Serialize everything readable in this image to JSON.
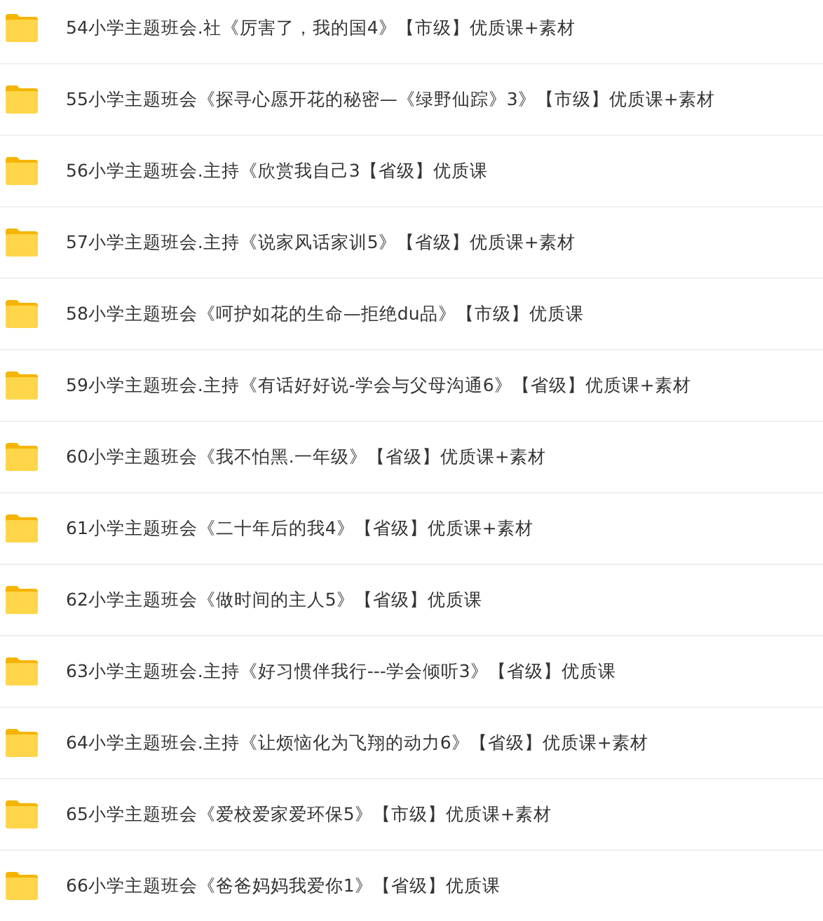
{
  "items": [
    {
      "name": "54小学主题班会.社《厉害了，我的国4》【市级】优质课+素材"
    },
    {
      "name": "55小学主题班会《探寻心愿开花的秘密—《绿野仙踪》3》【市级】优质课+素材"
    },
    {
      "name": "56小学主题班会.主持《欣赏我自己3【省级】优质课"
    },
    {
      "name": "57小学主题班会.主持《说家风话家训5》【省级】优质课+素材"
    },
    {
      "name": "58小学主题班会《呵护如花的生命—拒绝du品》【市级】优质课"
    },
    {
      "name": "59小学主题班会.主持《有话好好说-学会与父母沟通6》【省级】优质课+素材"
    },
    {
      "name": "60小学主题班会《我不怕黑.一年级》【省级】优质课+素材"
    },
    {
      "name": "61小学主题班会《二十年后的我4》【省级】优质课+素材"
    },
    {
      "name": "62小学主题班会《做时间的主人5》【省级】优质课"
    },
    {
      "name": "63小学主题班会.主持《好习惯伴我行---学会倾听3》【省级】优质课"
    },
    {
      "name": "64小学主题班会.主持《让烦恼化为飞翔的动力6》【省级】优质课+素材"
    },
    {
      "name": "65小学主题班会《爱校爱家爱环保5》【市级】优质课+素材"
    },
    {
      "name": "66小学主题班会《爸爸妈妈我爱你1》【省级】优质课"
    }
  ]
}
